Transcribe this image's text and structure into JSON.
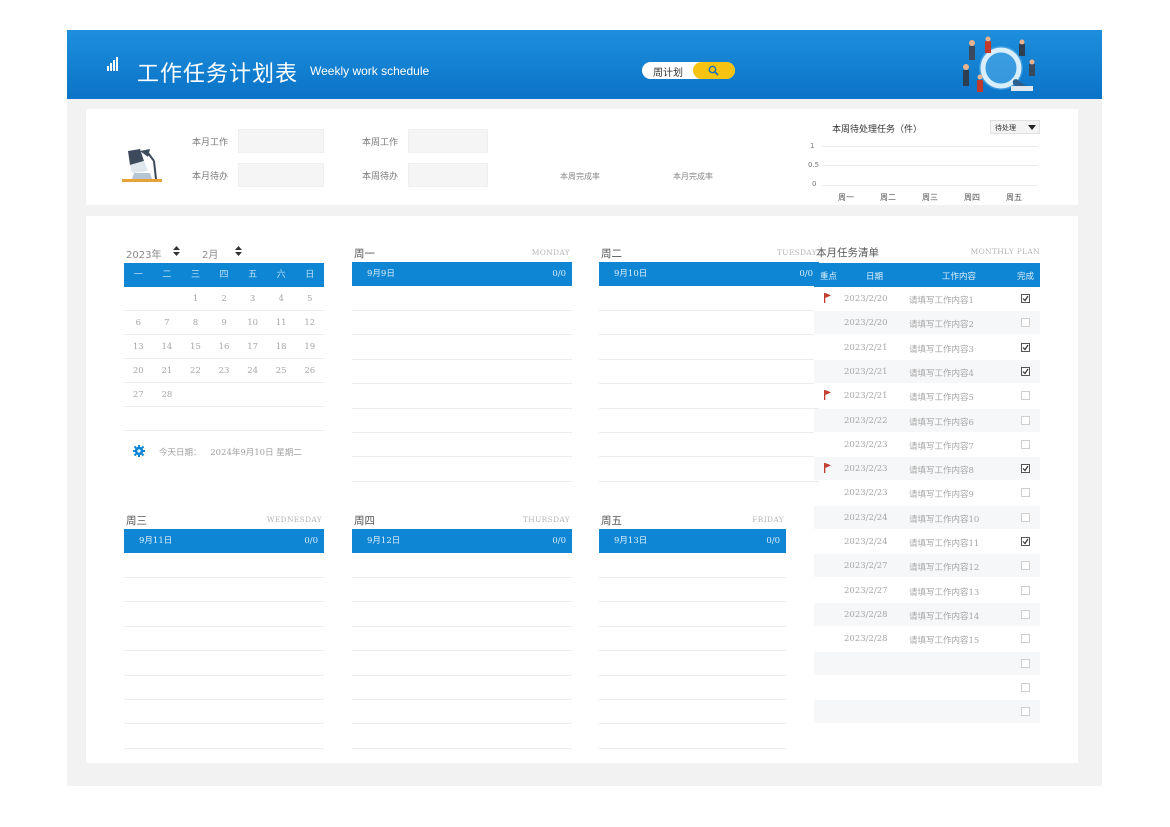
{
  "header": {
    "title": "工作任务计划表",
    "subtitle": "Weekly work schedule",
    "search_label": "周计划",
    "colors": {
      "bar": "#0a73c7",
      "search_button": "#f7c311"
    }
  },
  "stats": {
    "month_work_label": "本月工作",
    "month_pending_label": "本月待办",
    "week_work_label": "本周工作",
    "week_pending_label": "本周待办",
    "week_rate_label": "本周完成率",
    "month_rate_label": "本月完成率",
    "chart": {
      "title": "本周待处理任务（件）",
      "select_value": "待处理",
      "yticks": [
        "1",
        "0.5",
        "0"
      ],
      "xticks": [
        "周一",
        "周二",
        "周三",
        "周四",
        "周五"
      ]
    }
  },
  "chart_data": {
    "type": "bar",
    "title": "本周待处理任务（件）",
    "categories": [
      "周一",
      "周二",
      "周三",
      "周四",
      "周五"
    ],
    "values": [
      0,
      0,
      0,
      0,
      0
    ],
    "ylim": [
      0,
      1
    ],
    "grid": true
  },
  "calendar": {
    "year": "2023年",
    "month": "2月",
    "weekdays": [
      "一",
      "二",
      "三",
      "四",
      "五",
      "六",
      "日"
    ],
    "rows": [
      [
        "",
        "",
        "1",
        "2",
        "3",
        "4",
        "5"
      ],
      [
        "6",
        "7",
        "8",
        "9",
        "10",
        "11",
        "12"
      ],
      [
        "13",
        "14",
        "15",
        "16",
        "17",
        "18",
        "19"
      ],
      [
        "20",
        "21",
        "22",
        "23",
        "24",
        "25",
        "26"
      ],
      [
        "27",
        "28",
        "",
        "",
        "",
        "",
        ""
      ],
      [
        "",
        "",
        "",
        "",
        "",
        "",
        ""
      ]
    ],
    "today_label": "今天日期：",
    "today_value": "2024年9月10日 星期二"
  },
  "days": [
    {
      "name": "周一",
      "en": "MONDAY",
      "date": "9月9日",
      "count": "0/0"
    },
    {
      "name": "周二",
      "en": "TUESDAY",
      "date": "9月10日",
      "count": "0/0"
    },
    {
      "name": "周三",
      "en": "WEDNESDAY",
      "date": "9月11日",
      "count": "0/0"
    },
    {
      "name": "周四",
      "en": "THURSDAY",
      "date": "9月12日",
      "count": "0/0"
    },
    {
      "name": "周五",
      "en": "FRIDAY",
      "date": "9月13日",
      "count": "0/0"
    }
  ],
  "plan": {
    "title": "本月任务清单",
    "title_en": "MONTHLY PLAN",
    "headers": [
      "重点",
      "日期",
      "工作内容",
      "完成"
    ],
    "flag_color": "#c0392b",
    "rows": [
      {
        "flag": true,
        "date": "2023/2/20",
        "task": "请填写工作内容1",
        "done": true
      },
      {
        "flag": false,
        "date": "2023/2/20",
        "task": "请填写工作内容2",
        "done": false
      },
      {
        "flag": false,
        "date": "2023/2/21",
        "task": "请填写工作内容3",
        "done": true
      },
      {
        "flag": false,
        "date": "2023/2/21",
        "task": "请填写工作内容4",
        "done": true
      },
      {
        "flag": true,
        "date": "2023/2/21",
        "task": "请填写工作内容5",
        "done": false
      },
      {
        "flag": false,
        "date": "2023/2/22",
        "task": "请填写工作内容6",
        "done": false
      },
      {
        "flag": false,
        "date": "2023/2/23",
        "task": "请填写工作内容7",
        "done": false
      },
      {
        "flag": true,
        "date": "2023/2/23",
        "task": "请填写工作内容8",
        "done": true
      },
      {
        "flag": false,
        "date": "2023/2/23",
        "task": "请填写工作内容9",
        "done": false
      },
      {
        "flag": false,
        "date": "2023/2/24",
        "task": "请填写工作内容10",
        "done": false
      },
      {
        "flag": false,
        "date": "2023/2/24",
        "task": "请填写工作内容11",
        "done": true
      },
      {
        "flag": false,
        "date": "2023/2/27",
        "task": "请填写工作内容12",
        "done": false
      },
      {
        "flag": false,
        "date": "2023/2/27",
        "task": "请填写工作内容13",
        "done": false
      },
      {
        "flag": false,
        "date": "2023/2/28",
        "task": "请填写工作内容14",
        "done": false
      },
      {
        "flag": false,
        "date": "2023/2/28",
        "task": "请填写工作内容15",
        "done": false
      },
      {
        "flag": false,
        "date": "",
        "task": "",
        "done": false
      },
      {
        "flag": false,
        "date": "",
        "task": "",
        "done": false
      },
      {
        "flag": false,
        "date": "",
        "task": "",
        "done": false
      }
    ]
  }
}
